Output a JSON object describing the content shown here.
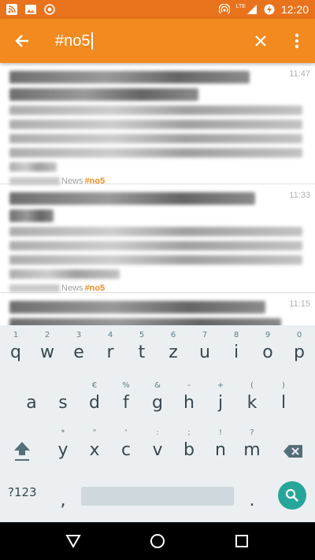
{
  "status_bar": {
    "time": "12:20",
    "network": "LTE"
  },
  "app_bar": {
    "query": "#no5",
    "colors": {
      "accent": "#f28a1f",
      "status": "#e9731c"
    }
  },
  "list": {
    "items": [
      {
        "time": "11:47",
        "category": "News",
        "tag": "#no5"
      },
      {
        "time": "11:33",
        "category": "News",
        "tag": "#no5"
      },
      {
        "time": "11:15"
      }
    ]
  },
  "keyboard": {
    "row1": [
      {
        "hint": "1",
        "ch": "q"
      },
      {
        "hint": "2",
        "ch": "w"
      },
      {
        "hint": "3",
        "ch": "e"
      },
      {
        "hint": "4",
        "ch": "r"
      },
      {
        "hint": "5",
        "ch": "t"
      },
      {
        "hint": "6",
        "ch": "z"
      },
      {
        "hint": "7",
        "ch": "u"
      },
      {
        "hint": "8",
        "ch": "i"
      },
      {
        "hint": "9",
        "ch": "o"
      },
      {
        "hint": "0",
        "ch": "p"
      }
    ],
    "row2": [
      {
        "hint": "",
        "ch": "a"
      },
      {
        "hint": "",
        "ch": "s"
      },
      {
        "hint": "€",
        "ch": "d"
      },
      {
        "hint": "%",
        "ch": "f"
      },
      {
        "hint": "&",
        "ch": "g"
      },
      {
        "hint": "-",
        "ch": "h"
      },
      {
        "hint": "+",
        "ch": "j"
      },
      {
        "hint": "(",
        "ch": "k"
      },
      {
        "hint": ")",
        "ch": "l"
      }
    ],
    "row3": [
      {
        "hint": "*",
        "ch": "y"
      },
      {
        "hint": "\"",
        "ch": "x"
      },
      {
        "hint": "'",
        "ch": "c"
      },
      {
        "hint": ":",
        "ch": "v"
      },
      {
        "hint": ";",
        "ch": "b"
      },
      {
        "hint": "!",
        "ch": "n"
      },
      {
        "hint": "?",
        "ch": "m"
      }
    ],
    "symbols_label": "?123",
    "comma": ",",
    "period": "."
  },
  "icons": [
    "back-arrow-icon",
    "clear-icon",
    "more-vert-icon",
    "shift-icon",
    "backspace-icon",
    "search-icon",
    "nav-back-icon",
    "nav-home-icon",
    "nav-recents-icon"
  ]
}
